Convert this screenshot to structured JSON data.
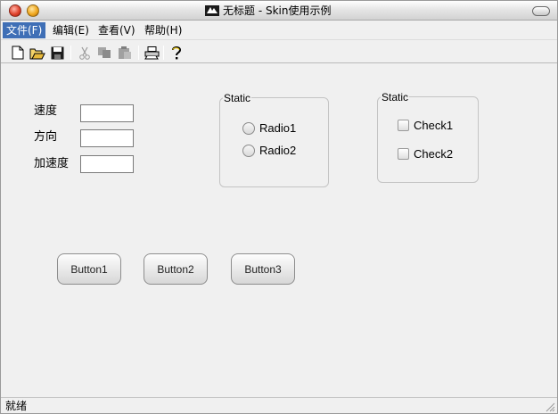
{
  "window": {
    "title": "无标题 - Skin使用示例"
  },
  "menubar": {
    "items": [
      {
        "label": "文件(F)"
      },
      {
        "label": "编辑(E)"
      },
      {
        "label": "查看(V)"
      },
      {
        "label": "帮助(H)"
      }
    ]
  },
  "toolbar": {
    "buttons": [
      "new-icon",
      "open-icon",
      "save-icon",
      "cut-icon",
      "copy-icon",
      "paste-icon",
      "print-icon",
      "help-icon"
    ]
  },
  "form": {
    "speed_label": "速度",
    "direction_label": "方向",
    "acceleration_label": "加速度",
    "speed_value": "",
    "direction_value": "",
    "acceleration_value": ""
  },
  "radio_group": {
    "title": "Static",
    "radio1": "Radio1",
    "radio2": "Radio2"
  },
  "check_group": {
    "title": "Static",
    "check1": "Check1",
    "check2": "Check2"
  },
  "buttons": {
    "button1": "Button1",
    "button2": "Button2",
    "button3": "Button3"
  },
  "statusbar": {
    "text": "就绪"
  },
  "colors": {
    "menu_active_bg": "#3f6fb6",
    "window_bg": "#f0f0f0"
  }
}
